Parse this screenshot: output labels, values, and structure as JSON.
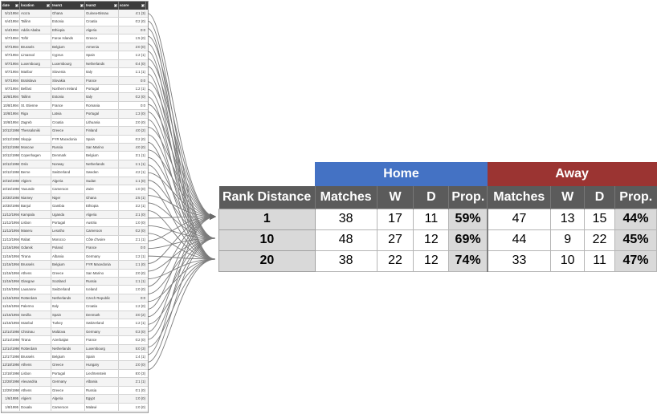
{
  "sheet": {
    "headers": [
      "date",
      "location",
      "team1",
      "team2",
      "score"
    ],
    "rows": [
      [
        "5/1/1994",
        "Accra",
        "Ghana",
        "Guinea-Bissau",
        "4:1 (3)"
      ],
      [
        "6/4/1994",
        "Tallinn",
        "Estonia",
        "Croatia",
        "0:2 (0)"
      ],
      [
        "6/4/1994",
        "Addis Ababa",
        "Ethiopia",
        "Algeria",
        "0:0"
      ],
      [
        "9/7/1994",
        "Toftir",
        "Faroe Islands",
        "Greece",
        "1:5 (0)"
      ],
      [
        "9/7/1994",
        "Brussels",
        "Belgium",
        "Armenia",
        "2:0 (0)"
      ],
      [
        "9/7/1994",
        "Limassol",
        "Cyprus",
        "Spain",
        "1:2 (1)"
      ],
      [
        "9/7/1994",
        "Luxembourg",
        "Luxembourg",
        "Netherlands",
        "0:4 (0)"
      ],
      [
        "9/7/1994",
        "Maribor",
        "Slovenia",
        "Italy",
        "1:1 (1)"
      ],
      [
        "9/7/1994",
        "Bratislava",
        "Slovakia",
        "France",
        "0:0"
      ],
      [
        "9/7/1994",
        "Belfast",
        "Northern Ireland",
        "Portugal",
        "1:2 (1)"
      ],
      [
        "10/8/1994",
        "Tallinn",
        "Estonia",
        "Italy",
        "0:2 (0)"
      ],
      [
        "10/8/1994",
        "St. Etienne",
        "France",
        "Romania",
        "0:0"
      ],
      [
        "10/8/1994",
        "Riga",
        "Latvia",
        "Portugal",
        "1:3 (0)"
      ],
      [
        "10/8/1994",
        "Zagreb",
        "Croatia",
        "Lithuania",
        "2:0 (0)"
      ],
      [
        "10/12/1994",
        "Thessaloniki",
        "Greece",
        "Finland",
        "4:0 (2)"
      ],
      [
        "10/12/1994",
        "Skopje",
        "FYR Macedonia",
        "Spain",
        "0:2 (0)"
      ],
      [
        "10/12/1994",
        "Moscow",
        "Russia",
        "San Marino",
        "4:0 (0)"
      ],
      [
        "10/12/1994",
        "Copenhagen",
        "Denmark",
        "Belgium",
        "3:1 (1)"
      ],
      [
        "10/12/1994",
        "Oslo",
        "Norway",
        "Netherlands",
        "1:1 (1)"
      ],
      [
        "10/12/1994",
        "Berne",
        "Switzerland",
        "Sweden",
        "4:2 (1)"
      ],
      [
        "10/16/1994",
        "Algiers",
        "Algeria",
        "Sudan",
        "1:1 (0)"
      ],
      [
        "10/16/1994",
        "Yaounde",
        "Cameroon",
        "Zaire",
        "1:0 (0)"
      ],
      [
        "10/30/1994",
        "Niamey",
        "Niger",
        "Ghana",
        "2:5 (1)"
      ],
      [
        "10/30/1994",
        "Banjul",
        "Gambia",
        "Ethiopia",
        "3:2 (1)"
      ],
      [
        "11/12/1994",
        "Kampala",
        "Uganda",
        "Algeria",
        "2:1 (0)"
      ],
      [
        "11/12/1994",
        "Lisbon",
        "Portugal",
        "Austria",
        "1:0 (0)"
      ],
      [
        "11/13/1994",
        "Maseru",
        "Lesotho",
        "Cameroon",
        "0:2 (0)"
      ],
      [
        "11/13/1994",
        "Rabat",
        "Morocco",
        "Côte d'Ivoire",
        "2:1 (1)"
      ],
      [
        "11/16/1994",
        "Gdansk",
        "Poland",
        "France",
        "0:0"
      ],
      [
        "11/16/1994",
        "Tirana",
        "Albania",
        "Germany",
        "1:2 (1)"
      ],
      [
        "11/16/1994",
        "Brussels",
        "Belgium",
        "FYR Macedonia",
        "1:1 (0)"
      ],
      [
        "11/16/1994",
        "Athens",
        "Greece",
        "San Marino",
        "2:0 (0)"
      ],
      [
        "11/16/1994",
        "Glasgow",
        "Scotland",
        "Russia",
        "1:1 (1)"
      ],
      [
        "11/16/1994",
        "Lausanne",
        "Switzerland",
        "Iceland",
        "1:0 (0)"
      ],
      [
        "11/16/1994",
        "Rotterdam",
        "Netherlands",
        "Czech Republic",
        "0:0"
      ],
      [
        "11/16/1994",
        "Palermo",
        "Italy",
        "Croatia",
        "1:2 (0)"
      ],
      [
        "11/16/1994",
        "Sevilla",
        "Spain",
        "Denmark",
        "3:0 (2)"
      ],
      [
        "11/16/1994",
        "Istanbul",
        "Turkey",
        "Switzerland",
        "1:2 (1)"
      ],
      [
        "12/14/1994",
        "Chisinau",
        "Moldova",
        "Germany",
        "0:3 (0)"
      ],
      [
        "12/14/1994",
        "Tirana",
        "Azerbaijan",
        "France",
        "0:2 (0)"
      ],
      [
        "12/14/1994",
        "Rotterdam",
        "Netherlands",
        "Luxembourg",
        "5:0 (3)"
      ],
      [
        "12/17/1994",
        "Brussels",
        "Belgium",
        "Spain",
        "1:4 (1)"
      ],
      [
        "12/18/1994",
        "Athens",
        "Greece",
        "Hungary",
        "2:0 (0)"
      ],
      [
        "12/18/1994",
        "Lisbon",
        "Portugal",
        "Liechtenstein",
        "8:0 (3)"
      ],
      [
        "12/28/1994",
        "Alexandria",
        "Germany",
        "Albania",
        "2:1 (1)"
      ],
      [
        "12/29/1994",
        "Athens",
        "Greece",
        "Russia",
        "0:1 (0)"
      ],
      [
        "1/6/1995",
        "Algiers",
        "Algeria",
        "Egypt",
        "1:0 (0)"
      ],
      [
        "1/8/1995",
        "Douala",
        "Cameroon",
        "Malawi",
        "1:0 (0)"
      ]
    ]
  },
  "summary": {
    "groups": {
      "home": "Home",
      "away": "Away"
    },
    "columns": [
      "Rank Distance",
      "Matches",
      "W",
      "D",
      "Prop.",
      "Matches",
      "W",
      "D",
      "Prop."
    ],
    "rows": [
      {
        "rank": "1",
        "home": [
          "38",
          "17",
          "11",
          "59%"
        ],
        "away": [
          "47",
          "13",
          "15",
          "44%"
        ]
      },
      {
        "rank": "10",
        "home": [
          "48",
          "27",
          "12",
          "69%"
        ],
        "away": [
          "44",
          "9",
          "22",
          "45%"
        ]
      },
      {
        "rank": "20",
        "home": [
          "38",
          "22",
          "12",
          "74%"
        ],
        "away": [
          "33",
          "10",
          "11",
          "47%"
        ]
      }
    ],
    "colors": {
      "home": "#4472c4",
      "away": "#9b3432",
      "header": "#5b5b5b",
      "prop_fill": "#d9d9d9"
    }
  }
}
